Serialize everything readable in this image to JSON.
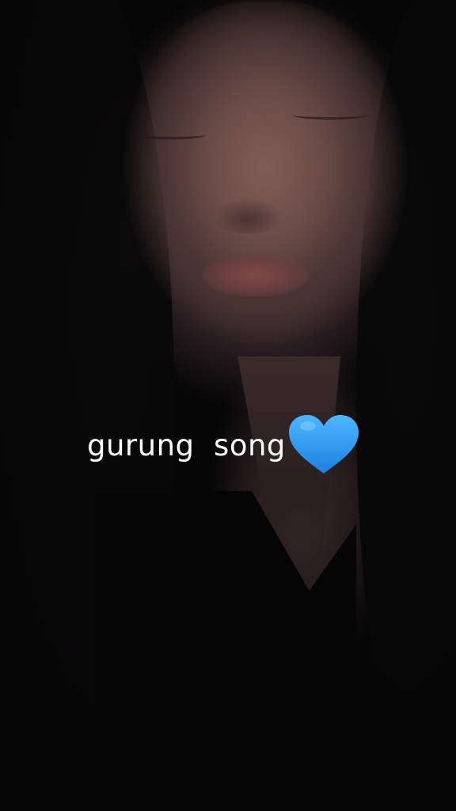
{
  "caption": {
    "text": "gurung  song",
    "heart_icon": "blue-heart-icon",
    "heart_color": "#2e9cf2"
  }
}
